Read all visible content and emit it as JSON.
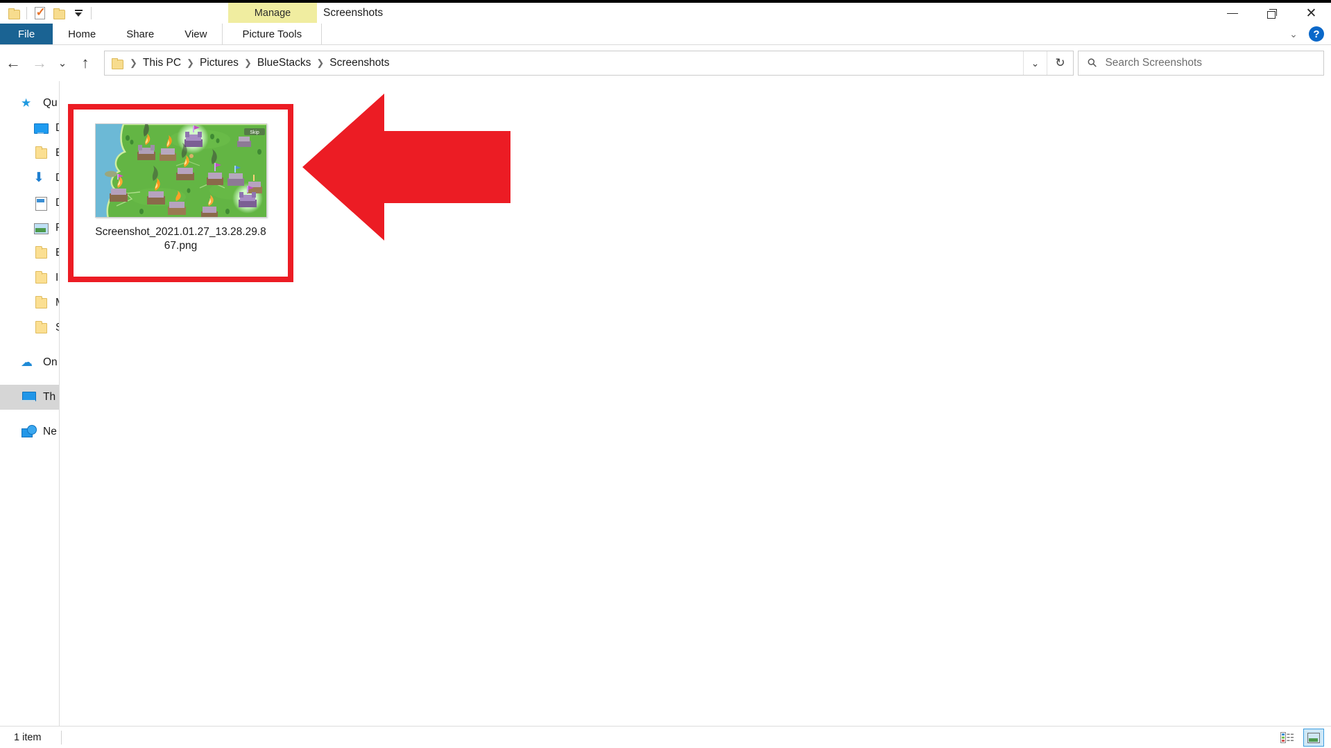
{
  "window": {
    "title": "Screenshots",
    "contextual_tab": "Manage",
    "controls": {
      "minimize": "minimize-button",
      "maximize": "restore-button",
      "close": "close-button"
    }
  },
  "quick_access_toolbar": {
    "items": [
      {
        "name": "folder-icon",
        "label": ""
      },
      {
        "name": "properties-icon",
        "label": ""
      },
      {
        "name": "new-folder-icon",
        "label": ""
      },
      {
        "name": "customize-dropdown-icon",
        "label": ""
      }
    ]
  },
  "ribbon": {
    "tabs": [
      {
        "label": "File",
        "active": true
      },
      {
        "label": "Home",
        "active": false
      },
      {
        "label": "Share",
        "active": false
      },
      {
        "label": "View",
        "active": false
      }
    ],
    "contextual_group": "Picture Tools",
    "collapse_label": "",
    "help_label": "?"
  },
  "address_bar": {
    "back": "←",
    "forward": "→",
    "recent": "⌄",
    "up": "↑",
    "breadcrumbs": [
      "This PC",
      "Pictures",
      "BlueStacks",
      "Screenshots"
    ],
    "separator": "❯",
    "dropdown": "⌄",
    "refresh": "↻"
  },
  "search": {
    "placeholder": "Search Screenshots",
    "icon": "search-icon"
  },
  "sidebar": {
    "items": [
      {
        "label": "Qu",
        "icon": "quick-access-star-icon",
        "selected": false,
        "indent": false
      },
      {
        "label": "D",
        "icon": "desktop-monitor-icon",
        "selected": false,
        "indent": true
      },
      {
        "label": "E",
        "icon": "folder-icon",
        "selected": false,
        "indent": true
      },
      {
        "label": "D",
        "icon": "downloads-arrow-icon",
        "selected": false,
        "indent": true
      },
      {
        "label": "D",
        "icon": "documents-icon",
        "selected": false,
        "indent": true
      },
      {
        "label": "P",
        "icon": "pictures-icon",
        "selected": false,
        "indent": true
      },
      {
        "label": "E",
        "icon": "folder-icon",
        "selected": false,
        "indent": true
      },
      {
        "label": "I",
        "icon": "folder-icon",
        "selected": false,
        "indent": true
      },
      {
        "label": "M",
        "icon": "folder-icon",
        "selected": false,
        "indent": true
      },
      {
        "label": "S",
        "icon": "folder-icon",
        "selected": false,
        "indent": true
      }
    ],
    "roots": [
      {
        "label": "On",
        "icon": "onedrive-cloud-icon",
        "selected": false
      },
      {
        "label": "Th",
        "icon": "this-pc-icon",
        "selected": true
      },
      {
        "label": "Ne",
        "icon": "network-icon",
        "selected": false
      }
    ]
  },
  "content": {
    "files": [
      {
        "name": "Screenshot_2021.01.27_13.28.29.867.png",
        "thumbnail": "game-map-screenshot-thumbnail",
        "selected": false
      }
    ]
  },
  "annotations": {
    "highlight_box_color": "#ec1c24",
    "arrow_color": "#ec1c24",
    "arrow_direction": "left"
  },
  "status_bar": {
    "item_count": "1 item",
    "views": [
      {
        "name": "details-view-button",
        "active": false
      },
      {
        "name": "large-icons-view-button",
        "active": true
      }
    ]
  }
}
